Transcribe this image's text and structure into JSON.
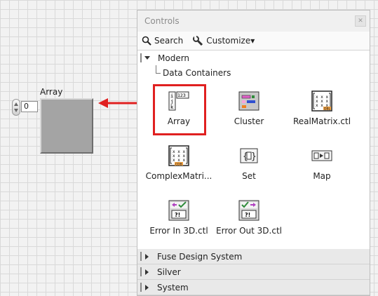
{
  "front_panel": {
    "array_label": "Array",
    "index_value": "0"
  },
  "palette": {
    "title": "Controls",
    "toolbar": {
      "search_label": "Search",
      "customize_label": "Customize▾"
    },
    "open_category": "Modern",
    "subcategory": "Data Containers",
    "items": [
      {
        "label": "Array",
        "icon": "array-icon"
      },
      {
        "label": "Cluster",
        "icon": "cluster-icon"
      },
      {
        "label": "RealMatrix.ctl",
        "icon": "real-matrix-icon"
      },
      {
        "label": "ComplexMatri...",
        "icon": "complex-matrix-icon"
      },
      {
        "label": "Set",
        "icon": "set-icon"
      },
      {
        "label": "Map",
        "icon": "map-icon"
      },
      {
        "label": "Error In 3D.ctl",
        "icon": "error-in-icon"
      },
      {
        "label": "Error Out 3D.ctl",
        "icon": "error-out-icon"
      }
    ],
    "closed_categories": [
      "Fuse Design System",
      "Silver",
      "System"
    ]
  },
  "colors": {
    "highlight": "#e02020",
    "arrow": "#e02020"
  }
}
